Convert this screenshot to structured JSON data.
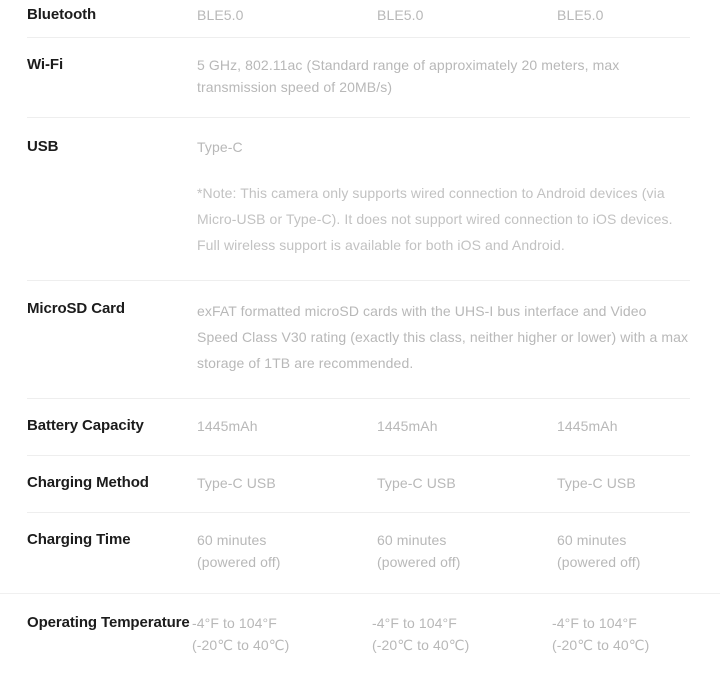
{
  "table": {
    "columns": 3,
    "label_color": "#1c1c1c",
    "value_color": "#b8b8b8",
    "divider_color": "#eeeeee",
    "rows": [
      {
        "label": "Bluetooth",
        "layout": "triple",
        "values": [
          "BLE5.0",
          "BLE5.0",
          "BLE5.0"
        ]
      },
      {
        "label": "Wi-Fi",
        "layout": "single",
        "values": [
          "5 GHz, 802.11ac (Standard range of approximately 20 meters, max transmission speed of 20MB/s)"
        ]
      },
      {
        "label": "USB",
        "layout": "single",
        "values": [
          "Type-C"
        ],
        "note": "*Note: This camera only supports wired connection to Android devices (via Micro-USB or Type-C). It does not support wired connection to iOS devices. Full wireless support is available for both iOS and Android."
      },
      {
        "label": "MicroSD Card",
        "layout": "single",
        "values": [
          "exFAT formatted microSD cards with the UHS-I bus interface and Video Speed Class V30 rating (exactly this class, neither higher or lower) with a max storage of 1TB are recommended."
        ]
      },
      {
        "label": "Battery Capacity",
        "layout": "triple",
        "values": [
          "1445mAh",
          "1445mAh",
          "1445mAh"
        ]
      },
      {
        "label": "Charging Method",
        "layout": "triple",
        "values": [
          "Type-C USB",
          "Type-C USB",
          "Type-C USB"
        ]
      },
      {
        "label": "Charging Time",
        "layout": "triple",
        "values": [
          "60 minutes\n(powered off)",
          "60 minutes\n(powered off)",
          "60 minutes\n(powered off)"
        ]
      },
      {
        "label": "Operating Temperature",
        "layout": "triple",
        "values": [
          "-4°F to 104°F\n(-20℃ to 40℃)",
          "-4°F to 104°F\n(-20℃ to 40℃)",
          "-4°F to 104°F\n(-20℃ to 40℃)"
        ]
      }
    ]
  }
}
